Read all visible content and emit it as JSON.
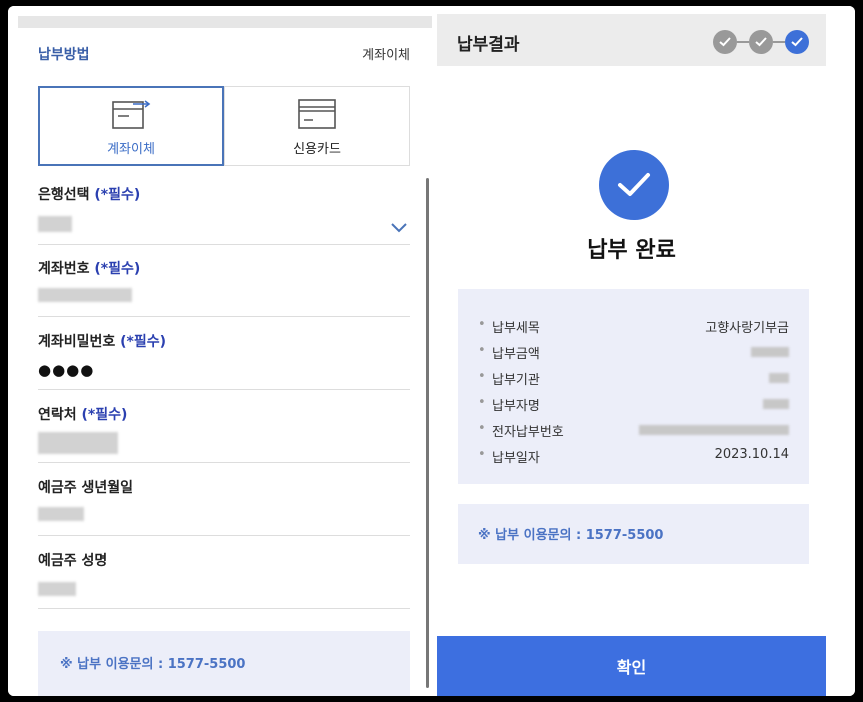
{
  "left": {
    "payment_method_label": "납부방법",
    "payment_method_value": "계좌이체",
    "tabs": [
      {
        "label": "계좌이체",
        "icon": "bank-transfer-icon"
      },
      {
        "label": "신용카드",
        "icon": "credit-card-icon"
      }
    ],
    "fields": [
      {
        "label": "은행선택",
        "required": "(*필수)"
      },
      {
        "label": "계좌번호",
        "required": "(*필수)"
      },
      {
        "label": "계좌비밀번호",
        "required": "(*필수)",
        "value": "●●●●"
      },
      {
        "label": "연락처",
        "required": "(*필수)"
      },
      {
        "label": "예금주 생년월일",
        "required": ""
      },
      {
        "label": "예금주 성명",
        "required": ""
      }
    ],
    "notice": "※ 납부 이용문의 : 1577-5500"
  },
  "right": {
    "title": "납부결과",
    "complete_title": "납부 완료",
    "rows": [
      {
        "label": "납부세목",
        "value": "고향사랑기부금"
      },
      {
        "label": "납부금액",
        "value": ""
      },
      {
        "label": "납부기관",
        "value": ""
      },
      {
        "label": "납부자명",
        "value": ""
      },
      {
        "label": "전자납부번호",
        "value": ""
      },
      {
        "label": "납부일자",
        "value": "2023.10.14"
      }
    ],
    "notice": "※ 납부 이용문의 : 1577-5500",
    "confirm_label": "확인"
  },
  "colors": {
    "accent": "#3d70d8",
    "label_blue": "#3a5fa8",
    "required_blue": "#2b40b0",
    "notice_bg": "#eceef9"
  }
}
